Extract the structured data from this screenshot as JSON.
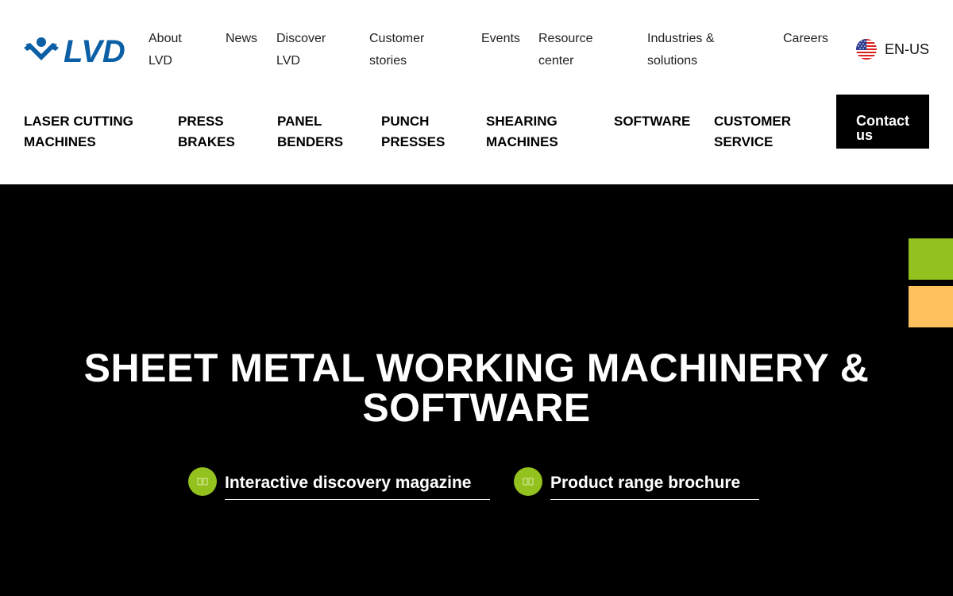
{
  "brand": {
    "logo_text": "LVD",
    "color": "#0b5fa5"
  },
  "top_nav": [
    {
      "line1": "About",
      "line2": "LVD"
    },
    {
      "line1": "News",
      "line2": ""
    },
    {
      "line1": "Discover",
      "line2": "LVD"
    },
    {
      "line1": "Customer",
      "line2": "stories"
    },
    {
      "line1": "Events",
      "line2": ""
    },
    {
      "line1": "Resource",
      "line2": "center"
    },
    {
      "line1": "Industries &",
      "line2": "solutions"
    },
    {
      "line1": "Careers",
      "line2": ""
    }
  ],
  "language": {
    "label": "EN-US",
    "icon": "us-flag-icon"
  },
  "main_nav": [
    {
      "line1": "LASER CUTTING",
      "line2": "MACHINES"
    },
    {
      "line1": "PRESS",
      "line2": "BRAKES"
    },
    {
      "line1": "PANEL",
      "line2": "BENDERS"
    },
    {
      "line1": "PUNCH",
      "line2": "PRESSES"
    },
    {
      "line1": "SHEARING",
      "line2": "MACHINES"
    },
    {
      "line1": "SOFTWARE",
      "line2": ""
    },
    {
      "line1": "CUSTOMER",
      "line2": "SERVICE"
    }
  ],
  "contact_button": {
    "line1": "Contact",
    "line2": "us"
  },
  "hero": {
    "title_line1": "SHEET METAL WORKING MACHINERY &",
    "title_line2": "SOFTWARE",
    "links": [
      {
        "label": "Interactive discovery magazine",
        "icon": "book-icon"
      },
      {
        "label": "Product range brochure",
        "icon": "book-icon"
      }
    ]
  },
  "colors": {
    "accent_green": "#93c11e",
    "accent_orange": "#ffc15e",
    "hero_bg": "#000000"
  }
}
